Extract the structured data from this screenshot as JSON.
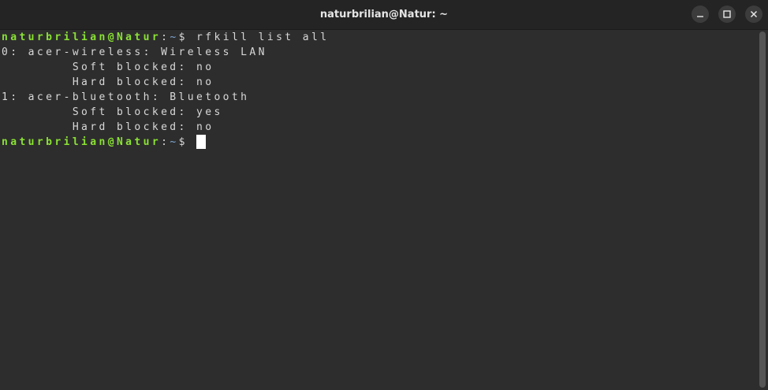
{
  "window": {
    "title": "naturbrilian@Natur: ~",
    "buttons": {
      "minimize": "minimize-icon",
      "maximize": "maximize-icon",
      "close": "close-icon"
    }
  },
  "terminal": {
    "prompt": {
      "user_host": "naturbrilian@Natur",
      "separator": ":",
      "path": "~",
      "symbol": "$ "
    },
    "command": "rfkill list all",
    "output": [
      "0: acer-wireless: Wireless LAN",
      "        Soft blocked: no",
      "        Hard blocked: no",
      "1: acer-bluetooth: Bluetooth",
      "        Soft blocked: yes",
      "        Hard blocked: no"
    ]
  },
  "colors": {
    "background": "#2d2d2d",
    "prompt_user": "#8ae234",
    "prompt_path": "#7fa8d4",
    "text": "#d8d8d8"
  }
}
